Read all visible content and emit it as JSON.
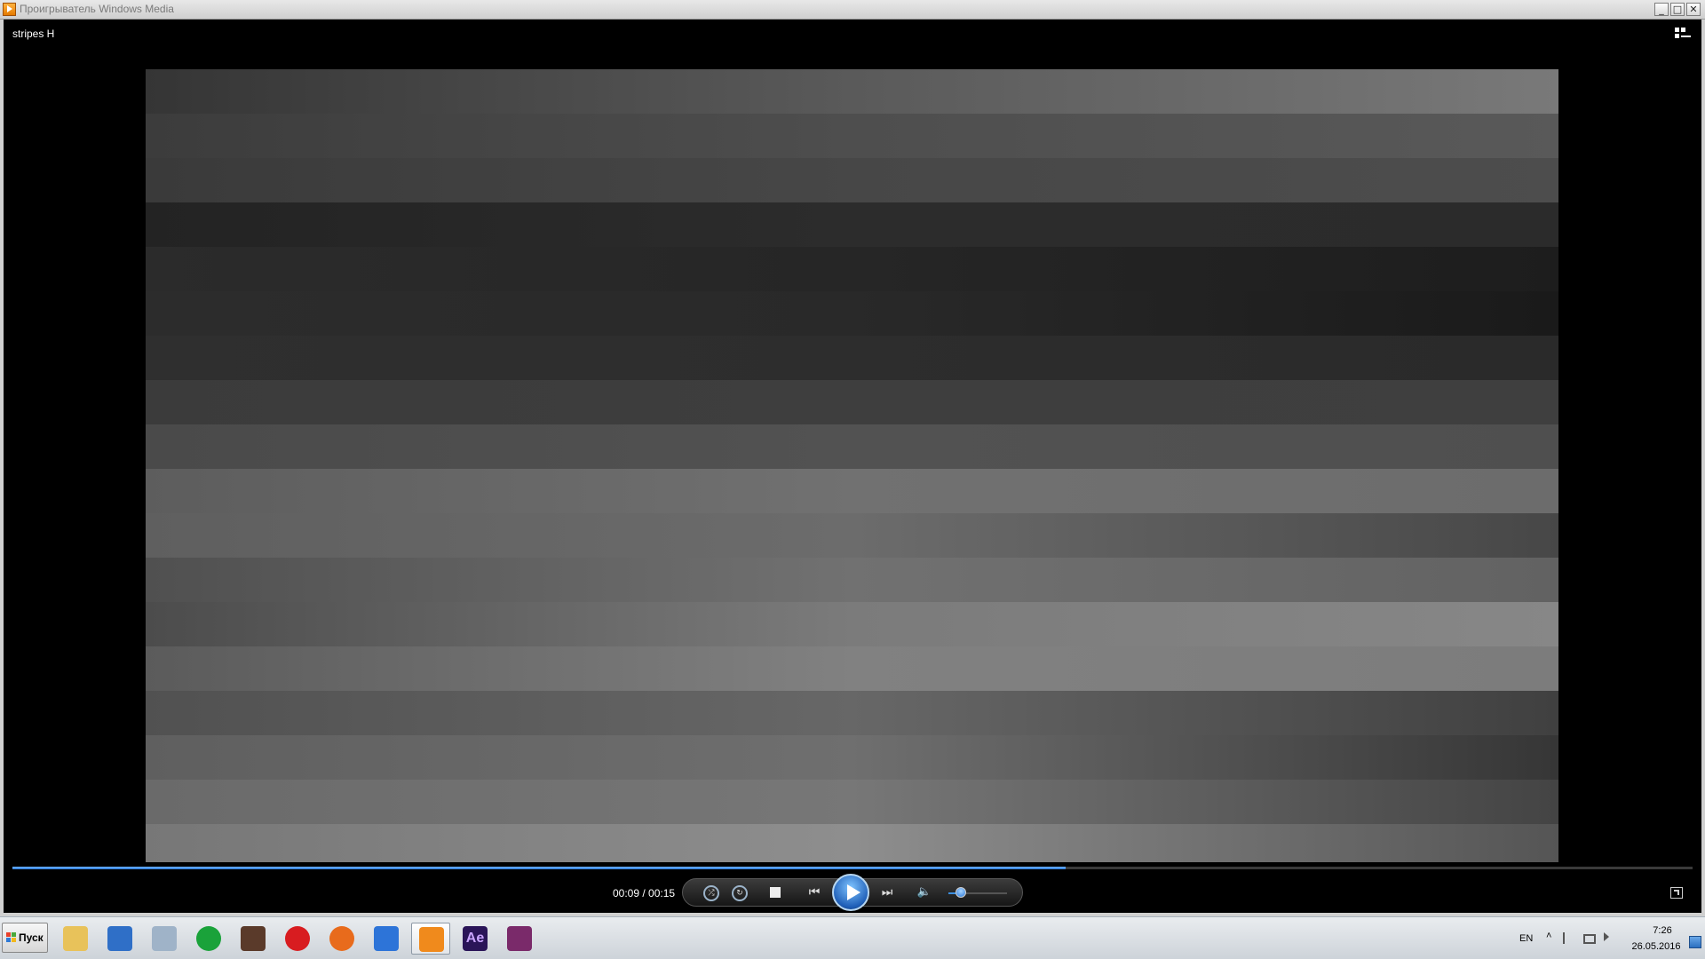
{
  "window": {
    "title": "Проигрыватель Windows Media",
    "controls": {
      "minimize": "_",
      "maximize": "□",
      "close": "✕"
    }
  },
  "player": {
    "media_title": "stripes H",
    "time_display": "00:09 / 00:15",
    "progress_fraction": 0.627,
    "volume_fraction": 0.15,
    "icons": {
      "shuffle": "⤮",
      "repeat": "↻",
      "prev": "⏮",
      "next": "⏭",
      "mute": "🔈"
    }
  },
  "video_stripes": [
    [
      "#353535",
      "#5a5a5a",
      "#797979"
    ],
    [
      "#3c3c3c",
      "#4e4e4e",
      "#595959"
    ],
    [
      "#3a3a3a",
      "#474747",
      "#4d4d4d"
    ],
    [
      "#232323",
      "#2c2c2c",
      "#2b2b2b"
    ],
    [
      "#2b2b2b",
      "#262626",
      "#1d1d1d"
    ],
    [
      "#2c2c2c",
      "#292929",
      "#1a1a1a"
    ],
    [
      "#2f2f2f",
      "#2d2d2d",
      "#2a2a2a"
    ],
    [
      "#3b3b3b",
      "#3e3e3e",
      "#3f3f3f"
    ],
    [
      "#4a4a4a",
      "#525252",
      "#4f4f4f"
    ],
    [
      "#5d5d5d",
      "#717171",
      "#6c6c6c"
    ],
    [
      "#5f5f5f",
      "#6c6c6c",
      "#474747"
    ],
    [
      "#505050",
      "#717171",
      "#626262"
    ],
    [
      "#4c4c4c",
      "#7b7b7b",
      "#878787"
    ],
    [
      "#5b5b5b",
      "#818181",
      "#7c7c7c"
    ],
    [
      "#515151",
      "#676767",
      "#404040"
    ],
    [
      "#5f5f5f",
      "#6f6f6f",
      "#363636"
    ],
    [
      "#6a6a6a",
      "#777777",
      "#444444"
    ],
    [
      "#777777",
      "#8e8e8e",
      "#555555"
    ]
  ],
  "taskbar": {
    "start_label": "Пуск",
    "apps": [
      {
        "name": "explorer",
        "color": "#e8c25a",
        "active": false
      },
      {
        "name": "media-center",
        "color": "#2f6fc7",
        "active": false
      },
      {
        "name": "calculator",
        "color": "#9fb3c8",
        "active": false
      },
      {
        "name": "mail-agent",
        "color": "#1aa23a",
        "active": false
      },
      {
        "name": "game",
        "color": "#5a3a2a",
        "active": false
      },
      {
        "name": "opera",
        "color": "#d81c20",
        "active": false
      },
      {
        "name": "firefox",
        "color": "#e86b1c",
        "active": false
      },
      {
        "name": "maxthon",
        "color": "#2d74d8",
        "active": false
      },
      {
        "name": "windows-media-player",
        "color": "#f08a1c",
        "active": true
      },
      {
        "name": "after-effects",
        "color": "#2a1558",
        "active": false,
        "label": "Ae"
      },
      {
        "name": "winrar",
        "color": "#7a2a6a",
        "active": false
      }
    ],
    "tray": {
      "language": "EN",
      "arrow": "˄",
      "time": "7:26",
      "date": "26.05.2016"
    }
  }
}
